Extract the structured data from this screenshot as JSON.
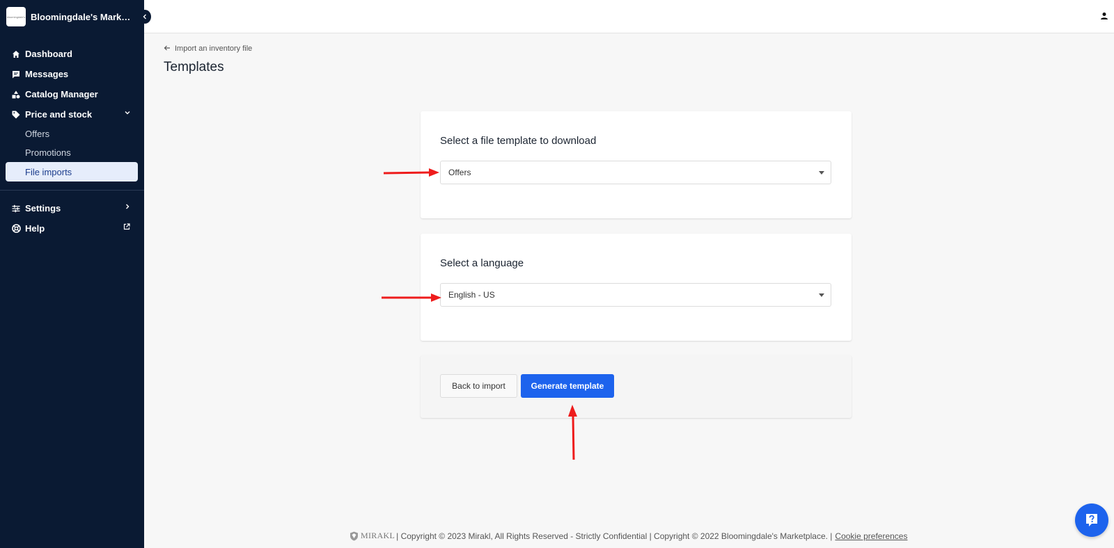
{
  "app": {
    "brand_name": "Bloomingdale's Marketp...",
    "brand_logo_text": "bloomingdale's"
  },
  "sidebar": {
    "items": [
      {
        "label": "Dashboard",
        "icon": "home-icon"
      },
      {
        "label": "Messages",
        "icon": "message-icon"
      },
      {
        "label": "Catalog Manager",
        "icon": "shapes-icon"
      },
      {
        "label": "Price and stock",
        "icon": "tag-icon",
        "expanded": true
      }
    ],
    "sub_items": [
      {
        "label": "Offers"
      },
      {
        "label": "Promotions"
      },
      {
        "label": "File imports",
        "active": true
      }
    ],
    "bottom_items": [
      {
        "label": "Settings",
        "icon": "sliders-icon"
      },
      {
        "label": "Help",
        "icon": "lifebuoy-icon"
      }
    ]
  },
  "breadcrumb": {
    "label": "Import an inventory file"
  },
  "page": {
    "title": "Templates"
  },
  "template_card": {
    "title": "Select a file template to download",
    "selected_value": "Offers"
  },
  "language_card": {
    "title": "Select a language",
    "selected_value": "English - US"
  },
  "actions": {
    "back_label": "Back to import",
    "generate_label": "Generate template"
  },
  "footer": {
    "mirakl_label": "MIRAKL",
    "text": "| Copyright © 2023 Mirakl, All Rights Reserved - Strictly Confidential | Copyright © 2022 Bloomingdale's Marketplace.  |",
    "cookie_label": "Cookie preferences"
  },
  "colors": {
    "sidebar_bg": "#0a1a33",
    "accent": "#1d63ed",
    "annotation": "#ee1c1c"
  }
}
